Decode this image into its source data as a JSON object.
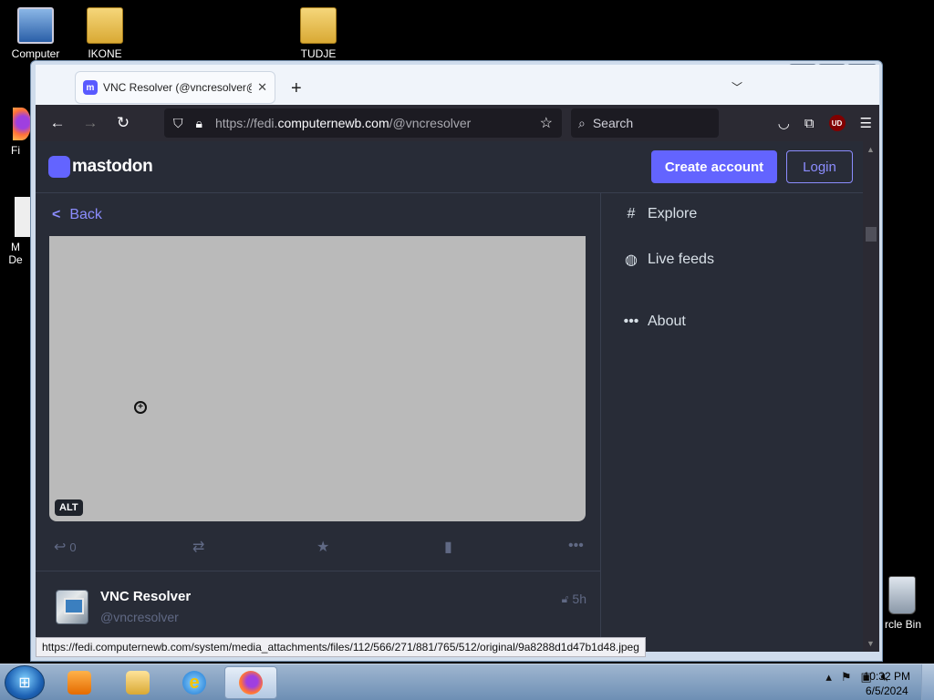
{
  "desktop": {
    "icons": [
      {
        "label": "Computer"
      },
      {
        "label": "IKONE"
      },
      {
        "label": "TUDJE"
      },
      {
        "label": "Fi"
      },
      {
        "label": "M"
      },
      {
        "label": "De"
      },
      {
        "label": "rcle Bin"
      }
    ]
  },
  "browser": {
    "tab_title": "VNC Resolver (@vncresolver@f",
    "tab_favicon": "m",
    "url_prefix": "https://fedi.",
    "url_domain": "computernewb.com",
    "url_path": "/@vncresolver",
    "search_placeholder": "Search",
    "status_url": "https://fedi.computernewb.com/system/media_attachments/files/112/566/271/881/765/512/original/9a8288d1d47b1d48.jpeg",
    "ublock_label": "UD"
  },
  "mastodon": {
    "logo_text": "mastodon",
    "create_account": "Create account",
    "login": "Login",
    "back": "Back",
    "alt_badge": "ALT",
    "reply_count": "0",
    "nav": [
      {
        "label": "Explore",
        "icon": "hashtag-icon"
      },
      {
        "label": "Live feeds",
        "icon": "globe-icon"
      },
      {
        "label": "About",
        "icon": "ellipsis-icon"
      }
    ],
    "status": {
      "display_name": "VNC Resolver",
      "handle": "@vncresolver",
      "time": "5h"
    },
    "colors": {
      "accent": "#6364ff",
      "background": "#282c37",
      "link": "#8c8dff"
    }
  },
  "taskbar": {
    "time": "10:32 PM",
    "date": "6/5/2024"
  }
}
